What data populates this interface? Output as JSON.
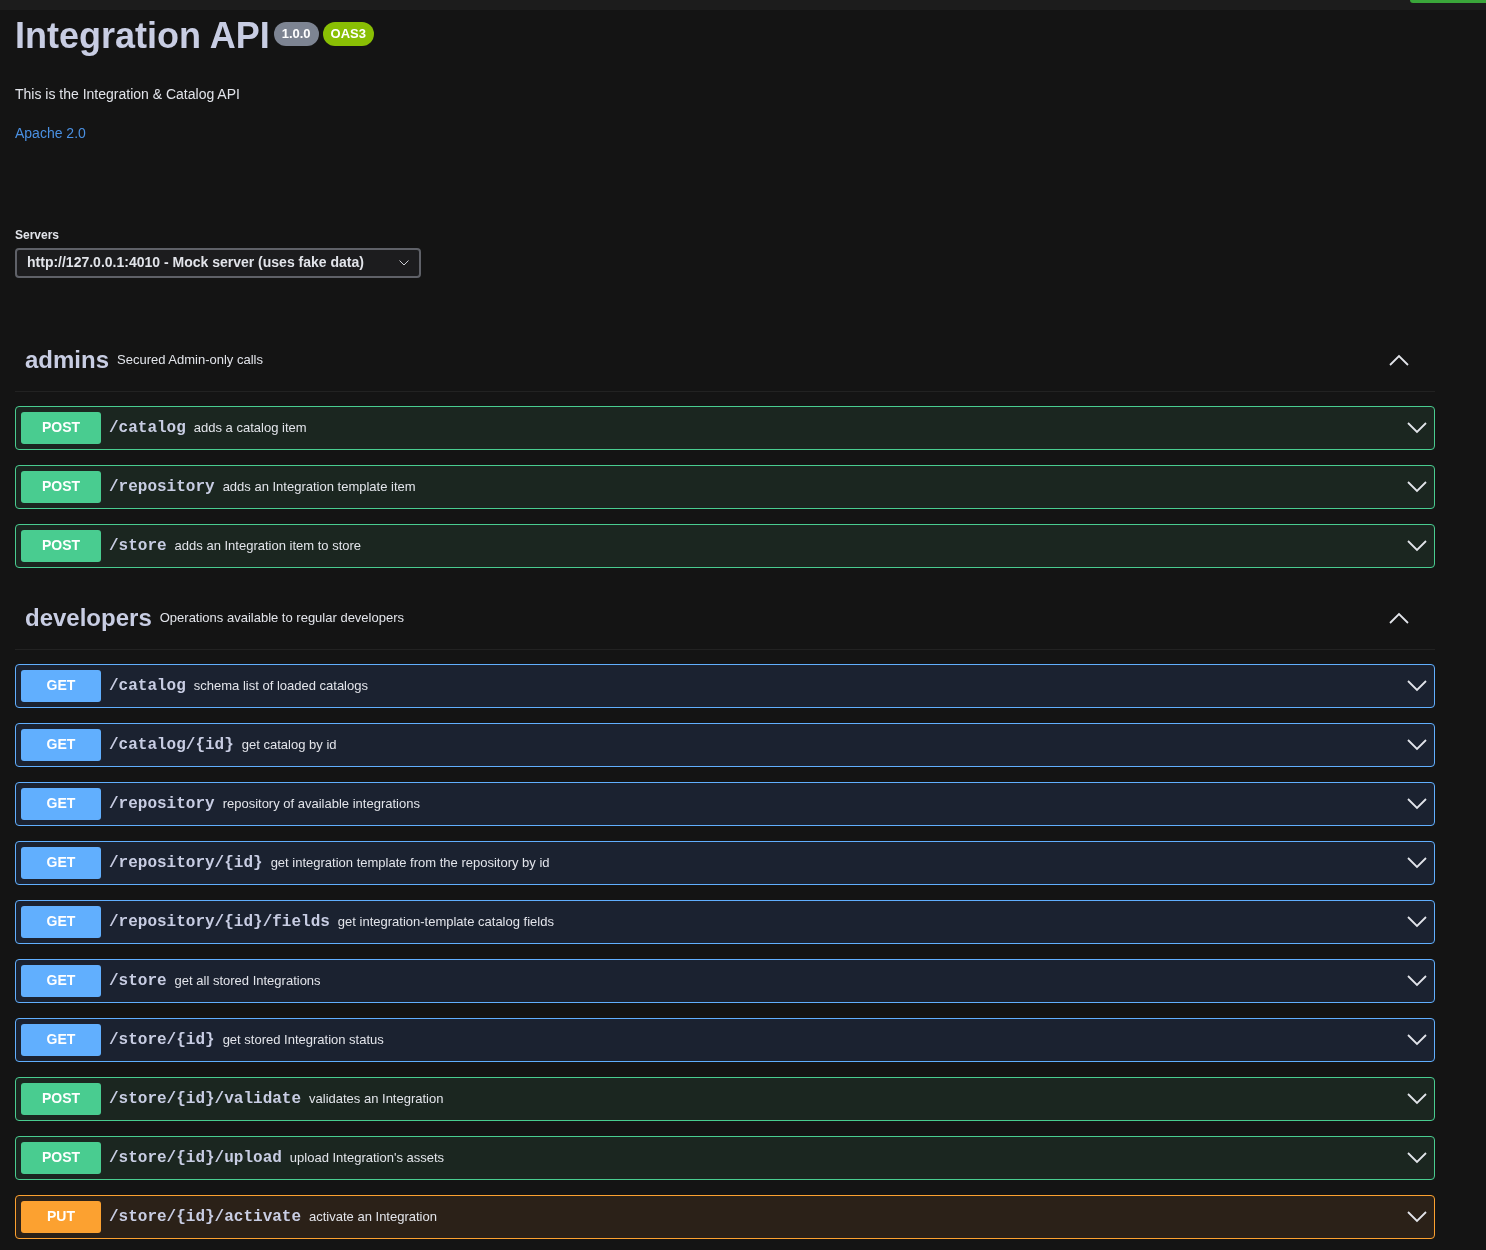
{
  "info": {
    "title": "Integration API",
    "version": "1.0.0",
    "spec": "OAS3",
    "description": "This is the Integration & Catalog API",
    "license": "Apache 2.0"
  },
  "servers": {
    "label": "Servers",
    "value": "http://127.0.0.1:4010 - Mock server (uses fake data)"
  },
  "sections": [
    {
      "name": "admins",
      "description": "Secured Admin-only calls",
      "expanded": true,
      "operations": [
        {
          "method": "POST",
          "path": "/catalog",
          "summary": "adds a catalog item"
        },
        {
          "method": "POST",
          "path": "/repository",
          "summary": "adds an Integration template item"
        },
        {
          "method": "POST",
          "path": "/store",
          "summary": "adds an Integration item to store"
        }
      ]
    },
    {
      "name": "developers",
      "description": "Operations available to regular developers",
      "expanded": true,
      "operations": [
        {
          "method": "GET",
          "path": "/catalog",
          "summary": "schema list of loaded catalogs"
        },
        {
          "method": "GET",
          "path": "/catalog/{id}",
          "summary": "get catalog by id"
        },
        {
          "method": "GET",
          "path": "/repository",
          "summary": "repository of available integrations"
        },
        {
          "method": "GET",
          "path": "/repository/{id}",
          "summary": "get integration template from the repository by id"
        },
        {
          "method": "GET",
          "path": "/repository/{id}/fields",
          "summary": "get integration-template catalog fields"
        },
        {
          "method": "GET",
          "path": "/store",
          "summary": "get all stored Integrations"
        },
        {
          "method": "GET",
          "path": "/store/{id}",
          "summary": "get stored Integration status"
        },
        {
          "method": "POST",
          "path": "/store/{id}/validate",
          "summary": "validates an Integration"
        },
        {
          "method": "POST",
          "path": "/store/{id}/upload",
          "summary": "upload Integration's assets"
        },
        {
          "method": "PUT",
          "path": "/store/{id}/activate",
          "summary": "activate an Integration"
        }
      ]
    }
  ]
}
